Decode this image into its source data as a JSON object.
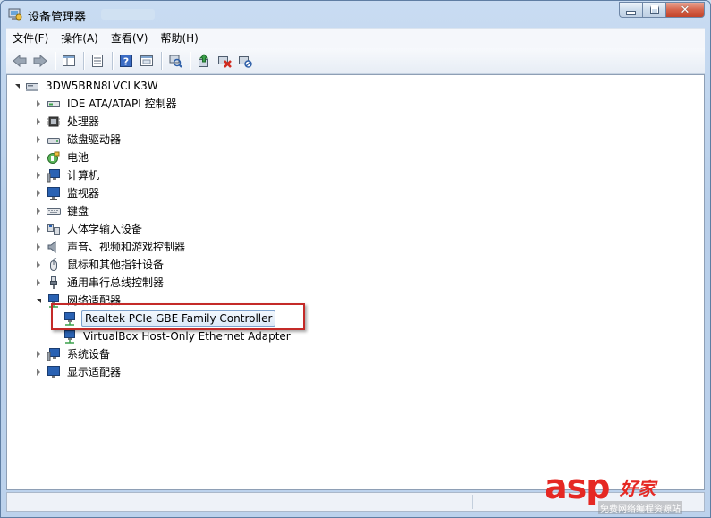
{
  "window": {
    "title": "设备管理器",
    "close_glyph": "✕"
  },
  "menu": {
    "items": [
      "文件(F)",
      "操作(A)",
      "查看(V)",
      "帮助(H)"
    ]
  },
  "toolbar": {
    "buttons": [
      "back-icon",
      "forward-icon",
      "|",
      "properties-grid-icon",
      "|",
      "console-tree-icon",
      "|",
      "help-icon",
      "view-icon",
      "|",
      "scan-hardware-icon",
      "|",
      "update-driver-icon",
      "uninstall-icon",
      "disable-icon"
    ]
  },
  "tree": {
    "root": "3DW5BRN8LVCLK3W",
    "categories": [
      {
        "label": "IDE ATA/ATAPI 控制器",
        "icon": "ide-controller-icon"
      },
      {
        "label": "处理器",
        "icon": "processor-icon"
      },
      {
        "label": "磁盘驱动器",
        "icon": "disk-drive-icon"
      },
      {
        "label": "电池",
        "icon": "battery-icon"
      },
      {
        "label": "计算机",
        "icon": "computer-icon"
      },
      {
        "label": "监视器",
        "icon": "monitor-icon"
      },
      {
        "label": "键盘",
        "icon": "keyboard-icon"
      },
      {
        "label": "人体学输入设备",
        "icon": "hid-icon"
      },
      {
        "label": "声音、视频和游戏控制器",
        "icon": "sound-icon"
      },
      {
        "label": "鼠标和其他指针设备",
        "icon": "mouse-icon"
      },
      {
        "label": "通用串行总线控制器",
        "icon": "usb-icon"
      },
      {
        "label": "网络适配器",
        "icon": "network-adapter-icon",
        "expanded": true
      },
      {
        "label": "系统设备",
        "icon": "system-device-icon"
      },
      {
        "label": "显示适配器",
        "icon": "display-adapter-icon"
      }
    ],
    "network_children": [
      {
        "label": "Realtek PCIe GBE Family Controller",
        "selected": true
      },
      {
        "label": "VirtualBox Host-Only Ethernet Adapter",
        "selected": false
      }
    ]
  },
  "watermark": {
    "brand": "asp",
    "brand_cn": "好家",
    "sub": "免费网络编程资源站"
  },
  "colors": {
    "highlight_box": "#c42a28",
    "watermark": "#e52823"
  }
}
